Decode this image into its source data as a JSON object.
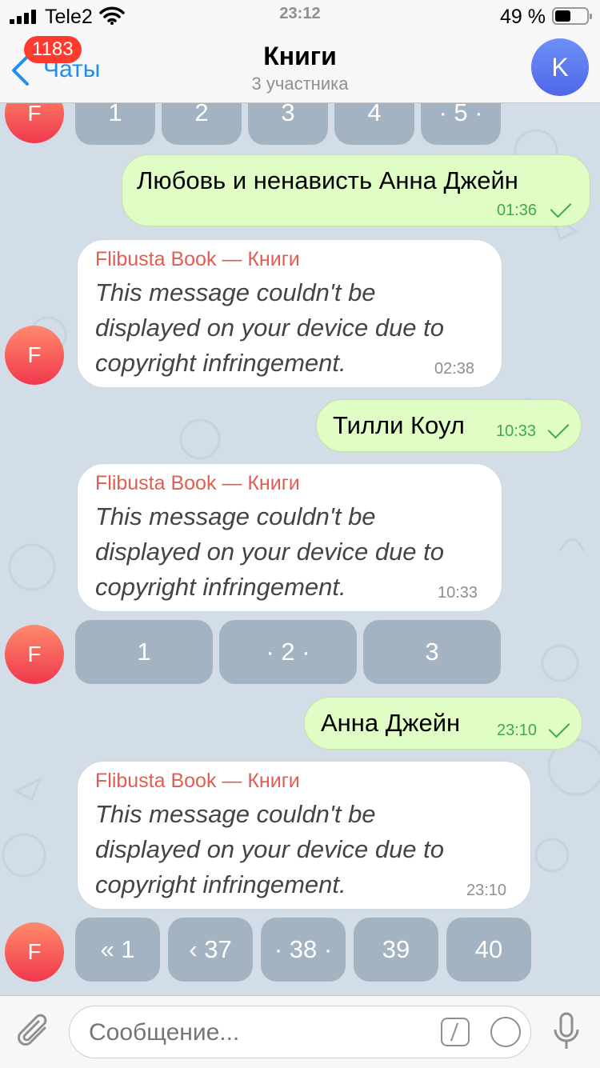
{
  "status_bar": {
    "carrier": "Tele2",
    "time": "23:12",
    "battery_percent": "49 %",
    "battery_level": 0.49
  },
  "header": {
    "back_label": "Чаты",
    "unread_count": "1183",
    "title": "Книги",
    "subtitle": "3 участника",
    "avatar_letter": "K"
  },
  "messages": [
    {
      "type": "keyboard",
      "buttons": [
        "1",
        "2",
        "3",
        "4",
        "· 5 ·"
      ]
    },
    {
      "type": "outgoing",
      "text": "Любовь и ненависть Анна Джейн",
      "time": "01:36"
    },
    {
      "type": "incoming",
      "avatar_letter": "F",
      "sender": "Flibusta Book — Книги",
      "lines": [
        "This message couldn't be",
        "displayed on your device due to",
        "copyright infringement."
      ],
      "time": "02:38"
    },
    {
      "type": "outgoing",
      "text": "Тилли Коул",
      "time": "10:33"
    },
    {
      "type": "incoming",
      "sender": "Flibusta Book — Книги",
      "lines": [
        "This message couldn't be",
        "displayed on your device due to",
        "copyright infringement."
      ],
      "time": "10:33"
    },
    {
      "type": "keyboard",
      "avatar_letter": "F",
      "buttons": [
        "1",
        "· 2 ·",
        "3"
      ]
    },
    {
      "type": "outgoing",
      "text": "Анна Джейн",
      "time": "23:10"
    },
    {
      "type": "incoming",
      "sender": "Flibusta Book — Книги",
      "lines": [
        "This message couldn't be",
        "displayed on your device due to",
        "copyright infringement."
      ],
      "time": "23:10"
    },
    {
      "type": "keyboard",
      "avatar_letter": "F",
      "buttons": [
        "« 1",
        "‹ 37",
        "· 38 ·",
        "39",
        "40"
      ]
    }
  ],
  "input": {
    "placeholder": "Сообщение..."
  },
  "colors": {
    "accent": "#1f8ef1",
    "outgoing_bubble": "#e1fdc6",
    "sender_name": "#e35c4f",
    "keyboard_button": "#a4b3c2",
    "badge": "#ff3b30"
  }
}
